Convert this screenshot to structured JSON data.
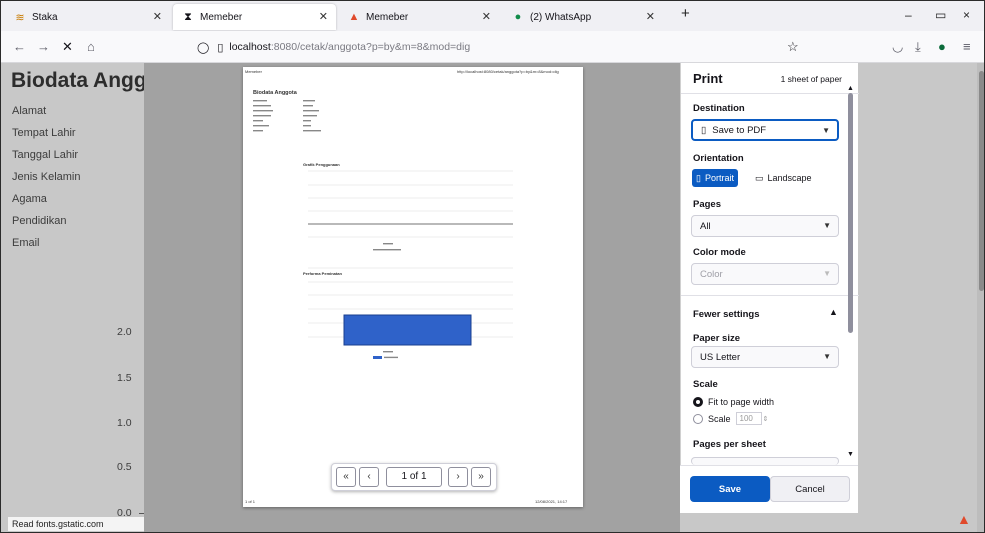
{
  "tabs": [
    {
      "label": "Staka",
      "icon": "staka-icon",
      "active": false
    },
    {
      "label": "Memeber",
      "icon": "hourglass-icon",
      "active": true
    },
    {
      "label": "Memeber",
      "icon": "flame-icon",
      "active": false
    },
    {
      "label": "(2) WhatsApp",
      "icon": "whatsapp-icon",
      "active": false
    }
  ],
  "new_tab": "+",
  "window": {
    "minimize": "–",
    "restore": "▭",
    "close": "×"
  },
  "nav": {
    "back": "←",
    "forward": "→",
    "stop": "✕",
    "home": "⌂"
  },
  "url": {
    "host": "localhost",
    "rest": ":8080/cetak/anggota?p=by&m=8&mod=dig"
  },
  "page": {
    "title": "Biodata Anggota",
    "fields": [
      "Alamat",
      "Tempat Lahir",
      "Tanggal Lahir",
      "Jenis Kelamin",
      "Agama",
      "Pendidikan",
      "Email"
    ],
    "y_ticks": [
      "2.0",
      "1.5",
      "1.0",
      "0.5",
      "0.0"
    ],
    "status": "Read fonts.gstatic.com"
  },
  "preview": {
    "header_left": "Memeber",
    "header_right": "http://localhost:8080/cetak/anggota?p=by&m=8&mod=dig",
    "doc_title": "Biodata Anggota",
    "footer_left": "1 of 1",
    "footer_right": "12/08/2021, 14:17",
    "chart1_title": "Grafik Penggunaan",
    "chart2_title": "Performa Peminatan",
    "pager": {
      "first": "«",
      "prev": "‹",
      "label": "1 of 1",
      "next": "›",
      "last": "»"
    }
  },
  "print": {
    "title": "Print",
    "sheets": "1 sheet of paper",
    "destination_label": "Destination",
    "destination": "Save to PDF",
    "orientation_label": "Orientation",
    "portrait": "Portrait",
    "landscape": "Landscape",
    "pages_label": "Pages",
    "pages": "All",
    "color_label": "Color mode",
    "color": "Color",
    "fewer": "Fewer settings",
    "paper_label": "Paper size",
    "paper": "US Letter",
    "scale_label": "Scale",
    "fit": "Fit to page width",
    "scale": "Scale",
    "scale_value": "100",
    "pps_label": "Pages per sheet",
    "save": "Save",
    "cancel": "Cancel"
  },
  "colors": {
    "accent": "#0b5bc2",
    "bar": "#2f62c9"
  }
}
